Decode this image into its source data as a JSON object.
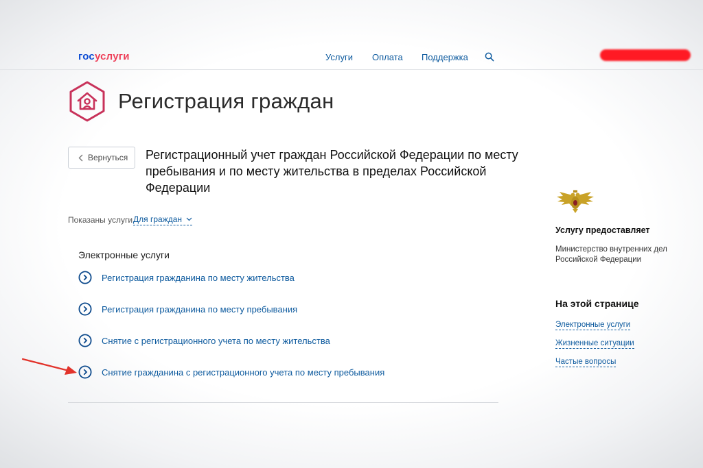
{
  "header": {
    "logo_part1": "гос",
    "logo_part2": "услуги",
    "nav": [
      "Услуги",
      "Оплата",
      "Поддержка"
    ]
  },
  "page_title": "Регистрация граждан",
  "back_label": "Вернуться",
  "service_title": "Регистрационный учет граждан Российской Федерации по месту пребывания и по месту жительства в пределах Российской Федерации",
  "filter": {
    "label": "Показаны услуги",
    "value": "Для граждан"
  },
  "electronic": {
    "heading": "Электронные услуги",
    "items": [
      "Регистрация гражданина по месту жительства",
      "Регистрация гражданина по месту пребывания",
      "Снятие с регистрационного учета по месту жительства",
      "Снятие гражданина с регистрационного учета по месту пребывания"
    ]
  },
  "sidebar": {
    "provider_heading": "Услугу предоставляет",
    "provider_name": "Министерство внутренних дел Российской Федерации",
    "onpage_heading": "На этой странице",
    "links": [
      "Электронные услуги",
      "Жизненные ситуации",
      "Частые вопросы"
    ]
  },
  "colors": {
    "brand_blue": "#0d4cd3",
    "brand_red": "#ee3f58",
    "link": "#0d5a9e",
    "title_icon": "#c8325a",
    "annotation_arrow": "#e2332b"
  },
  "icons": [
    "search-icon",
    "house-person-icon",
    "chevron-left-icon",
    "chevron-down-icon",
    "circle-arrow-icon",
    "emblem-icon",
    "red-arrow-icon"
  ]
}
